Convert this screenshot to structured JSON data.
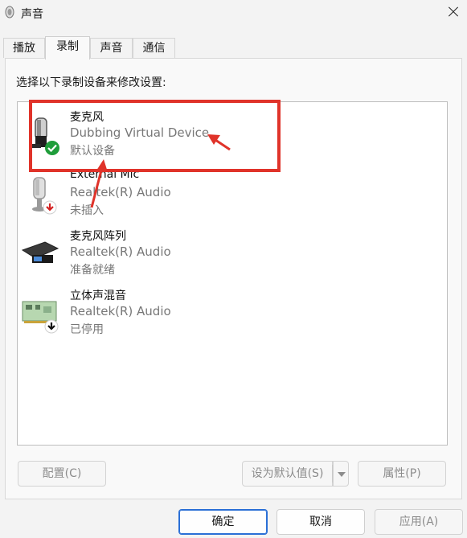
{
  "window": {
    "title": "声音",
    "app_icon": "speaker-icon",
    "close_icon": "close-icon"
  },
  "tabs": [
    {
      "label": "播放",
      "active": false
    },
    {
      "label": "录制",
      "active": true
    },
    {
      "label": "声音",
      "active": false
    },
    {
      "label": "通信",
      "active": false
    }
  ],
  "instruction": "选择以下录制设备来修改设置:",
  "devices": [
    {
      "name": "麦克风",
      "driver": "Dubbing Virtual Device",
      "status": "默认设备",
      "icon": "microphone-icon",
      "badge": "green-check-icon"
    },
    {
      "name": "External Mic",
      "driver": "Realtek(R) Audio",
      "status": "未插入",
      "icon": "microphone-icon",
      "badge": "red-down-arrow-icon"
    },
    {
      "name": "麦克风阵列",
      "driver": "Realtek(R) Audio",
      "status": "准备就绪",
      "icon": "microphone-array-icon",
      "badge": ""
    },
    {
      "name": "立体声混音",
      "driver": "Realtek(R) Audio",
      "status": "已停用",
      "icon": "sound-card-icon",
      "badge": "black-down-arrow-icon"
    }
  ],
  "buttons": {
    "configure": "配置(C)",
    "set_default": "设为默认值(S)",
    "properties": "属性(P)",
    "ok": "确定",
    "cancel": "取消",
    "apply": "应用(A)"
  },
  "colors": {
    "highlight": "#e0332a",
    "accent": "#2a6fd6",
    "check": "#1f9d3a",
    "warn": "#d32020"
  }
}
